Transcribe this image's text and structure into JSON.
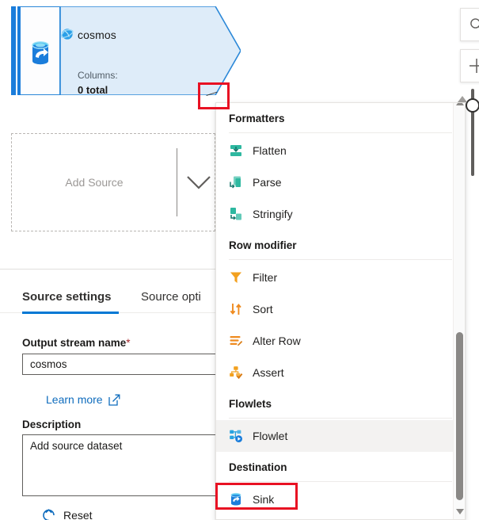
{
  "canvas": {
    "source_node": {
      "title": "cosmos",
      "columns_label": "Columns:",
      "columns_value": "0 total",
      "icon": "azure-cosmos-db-icon",
      "stream_icon": "source-database-icon",
      "accent_color": "#1b7ddb",
      "body_color": "#deecf9"
    },
    "add_source": {
      "label": "Add Source",
      "chevron_icon": "chevron-down-icon"
    }
  },
  "rail": {
    "search_label": "search-icon",
    "add_label": "plus-icon",
    "zoom_slider": "zoom-slider"
  },
  "menu": {
    "groups": [
      {
        "title": "Formatters",
        "items": [
          {
            "label": "Flatten",
            "icon": "flatten-icon",
            "color": "#2eb8a0",
            "highlighted": false
          },
          {
            "label": "Parse",
            "icon": "parse-icon",
            "color": "#2eb8a0",
            "highlighted": false
          },
          {
            "label": "Stringify",
            "icon": "stringify-icon",
            "color": "#2eb8a0",
            "highlighted": false
          }
        ]
      },
      {
        "title": "Row modifier",
        "items": [
          {
            "label": "Filter",
            "icon": "filter-icon",
            "color": "#f2a01e",
            "highlighted": false
          },
          {
            "label": "Sort",
            "icon": "sort-icon",
            "color": "#ef8b1f",
            "highlighted": false
          },
          {
            "label": "Alter Row",
            "icon": "alter-row-icon",
            "color": "#ef8b1f",
            "highlighted": false
          },
          {
            "label": "Assert",
            "icon": "assert-icon",
            "color": "#f2a01e",
            "highlighted": false
          }
        ]
      },
      {
        "title": "Flowlets",
        "items": [
          {
            "label": "Flowlet",
            "icon": "flowlet-icon",
            "color": "#29a3e0",
            "highlighted": true
          }
        ]
      },
      {
        "title": "Destination",
        "items": [
          {
            "label": "Sink",
            "icon": "sink-icon",
            "color": "#1b7ddb",
            "highlighted": false
          }
        ]
      }
    ]
  },
  "settings": {
    "tabs": [
      {
        "label": "Source settings",
        "active": true
      },
      {
        "label": "Source opti",
        "active": false
      }
    ],
    "output_stream_name": {
      "label": "Output stream name",
      "required_marker": "*",
      "value": "cosmos"
    },
    "learn_more": {
      "label": "Learn more",
      "icon": "external-link-icon"
    },
    "description": {
      "label": "Description",
      "value": "Add source dataset"
    },
    "reset": {
      "label": "Reset",
      "icon": "reset-icon"
    }
  },
  "highlights": {
    "expand_box": "expand-node-highlight",
    "sink_box": "sink-menu-item-highlight",
    "color": "#e81123"
  }
}
